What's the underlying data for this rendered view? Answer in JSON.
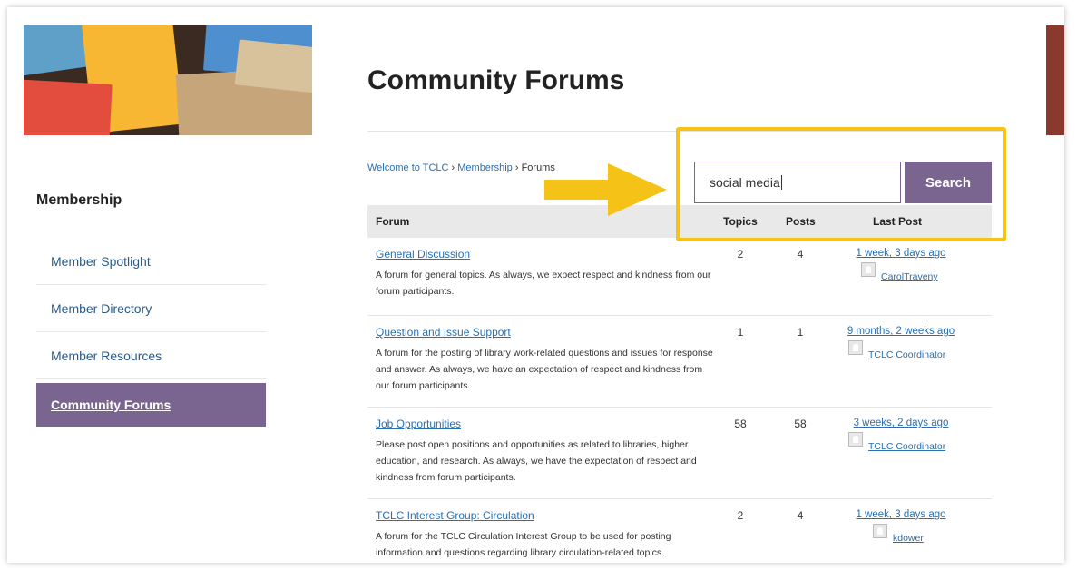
{
  "sidebar": {
    "title": "Membership",
    "items": [
      {
        "label": "Member Spotlight"
      },
      {
        "label": "Member Directory"
      },
      {
        "label": "Member Resources"
      },
      {
        "label": "Community Forums",
        "active": true
      }
    ]
  },
  "main": {
    "title": "Community Forums",
    "breadcrumb": {
      "home": "Welcome to TCLC",
      "sep1": " › ",
      "section": "Membership",
      "sep2": " › ",
      "current": "Forums"
    },
    "search": {
      "value": "social media",
      "button": "Search"
    },
    "table": {
      "headers": {
        "forum": "Forum",
        "topics": "Topics",
        "posts": "Posts",
        "last_post": "Last Post"
      },
      "rows": [
        {
          "name": "General Discussion",
          "desc": "A forum for general topics. As always, we expect respect and kindness from our forum participants.",
          "topics": "2",
          "posts": "4",
          "last": "1 week, 3 days ago",
          "user": "CarolTraveny"
        },
        {
          "name": "Question and Issue Support",
          "desc": "A forum for the posting of library work-related questions and issues for response and answer. As always, we have an expectation of respect and kindness from our forum participants.",
          "topics": "1",
          "posts": "1",
          "last": "9 months, 2 weeks ago",
          "user": "TCLC Coordinator"
        },
        {
          "name": "Job Opportunities",
          "desc": "Please post open positions and opportunities as related to libraries, higher education, and research. As always, we have the expectation of respect and kindness from forum participants.",
          "topics": "58",
          "posts": "58",
          "last": "3 weeks, 2 days ago",
          "user": "TCLC Coordinator"
        },
        {
          "name": "TCLC Interest Group: Circulation",
          "desc": "A forum for the TCLC Circulation Interest Group to be used for posting information and questions regarding library circulation-related topics.",
          "topics": "2",
          "posts": "4",
          "last": "1 week, 3 days ago",
          "user": "kdower"
        }
      ]
    }
  },
  "colors": {
    "accent": "#7a6591",
    "highlight": "#f5c218",
    "link": "#2a6fb0"
  }
}
